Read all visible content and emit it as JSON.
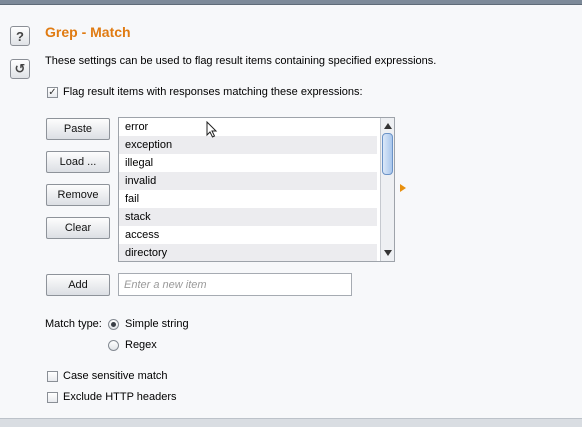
{
  "section": {
    "title": "Grep - Match",
    "description": "These settings can be used to flag result items containing specified expressions.",
    "help_icon": "?",
    "reset_icon": "↺"
  },
  "flag_checkbox": {
    "label": "Flag result items with responses matching these expressions:",
    "checked": true
  },
  "buttons": {
    "paste": "Paste",
    "load": "Load ...",
    "remove": "Remove",
    "clear": "Clear",
    "add": "Add"
  },
  "expressions": [
    "error",
    "exception",
    "illegal",
    "invalid",
    "fail",
    "stack",
    "access",
    "directory"
  ],
  "new_item": {
    "placeholder": "Enter a new item",
    "value": ""
  },
  "match_type": {
    "label": "Match type:",
    "options": [
      "Simple string",
      "Regex"
    ],
    "selected": "Simple string"
  },
  "options": {
    "case_sensitive": "Case sensitive match",
    "exclude_headers": "Exclude HTTP headers"
  },
  "colors": {
    "accent": "#e07b12"
  }
}
